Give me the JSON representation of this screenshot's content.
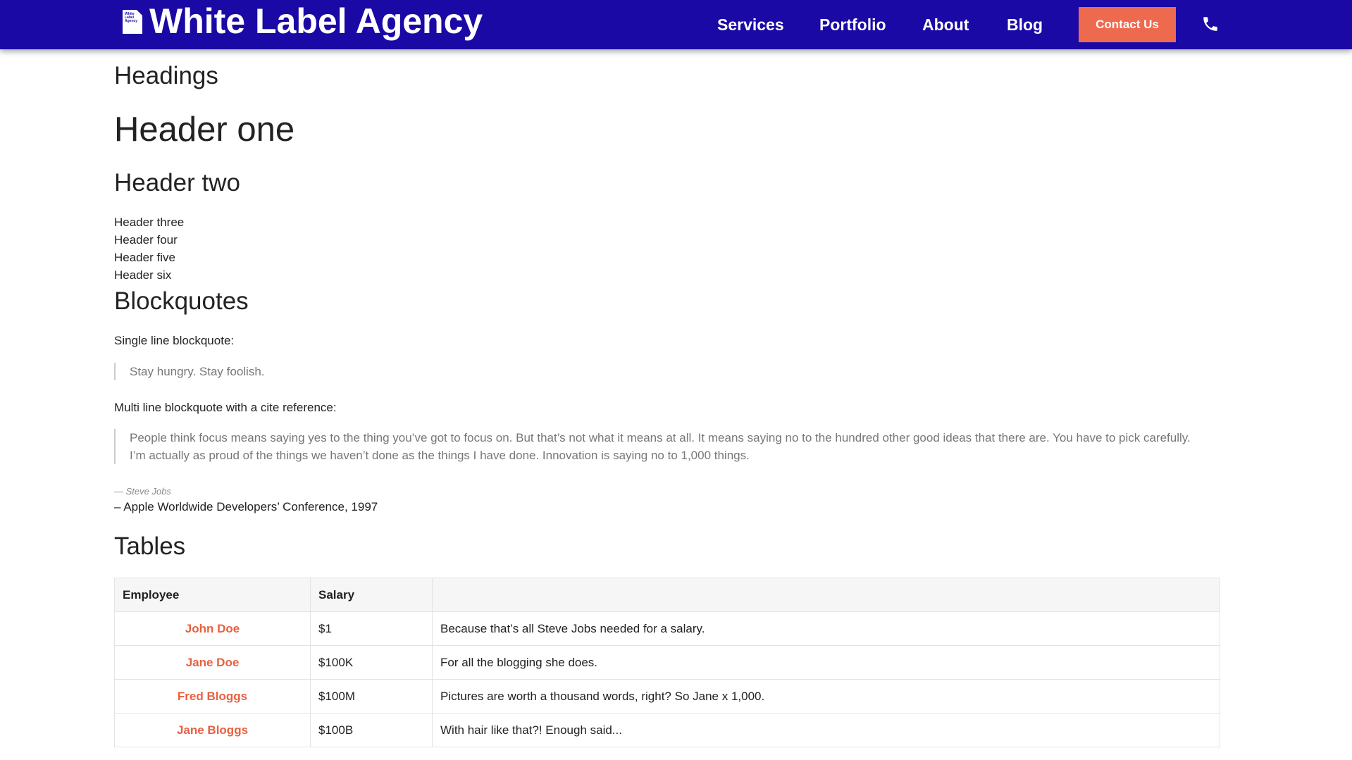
{
  "header": {
    "brand": "White Label Agency",
    "badge_text": "White Label Agency",
    "nav": [
      "Services",
      "Portfolio",
      "About",
      "Blog"
    ],
    "contact_label": "Contact Us",
    "colors": {
      "nav_bg": "#1b09a6",
      "accent": "#ee6a4f"
    },
    "phone_icon": "phone-icon"
  },
  "headings": {
    "section_title": "Headings",
    "h1": "Header one",
    "h2": "Header two",
    "h3": "Header three",
    "h4": "Header four",
    "h5": "Header five",
    "h6": "Header six"
  },
  "blockquotes": {
    "section_title": "Blockquotes",
    "single_label": "Single line blockquote:",
    "single_quote": "Stay hungry. Stay foolish.",
    "multi_label": "Multi line blockquote with a cite reference:",
    "multi_quote": "People think focus means saying yes to the thing you’ve got to focus on. But that’s not what it means at all. It means saying no to the hundred other good ideas that there are. You have to pick carefully. I’m actually as proud of the things we haven’t done as the things I have done. Innovation is saying no to 1,000 things.",
    "cite": "— Steve Jobs",
    "source": "– Apple Worldwide Developers’ Conference, 1997"
  },
  "tables": {
    "section_title": "Tables",
    "columns": [
      "Employee",
      "Salary",
      ""
    ],
    "rows": [
      {
        "name": "John Doe",
        "salary": "$1",
        "note": "Because that’s all Steve Jobs needed for a salary."
      },
      {
        "name": "Jane Doe",
        "salary": "$100K",
        "note": "For all the blogging she does."
      },
      {
        "name": "Fred Bloggs",
        "salary": "$100M",
        "note": "Pictures are worth a thousand words, right? So Jane x 1,000."
      },
      {
        "name": "Jane Bloggs",
        "salary": "$100B",
        "note": "With hair like that?! Enough said..."
      }
    ]
  }
}
